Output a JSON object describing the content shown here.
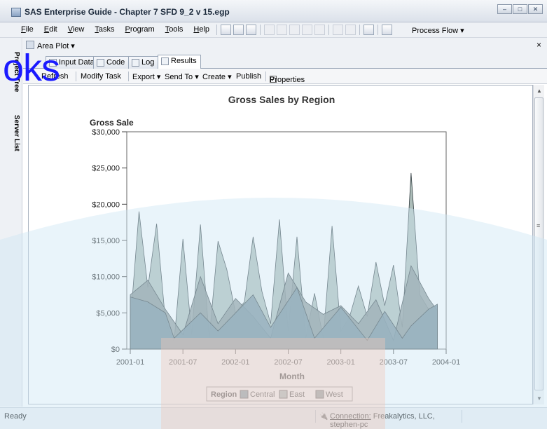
{
  "window": {
    "title": "SAS Enterprise Guide - Chapter 7 SFD 9_2 v 15.egp",
    "min_btn": "–",
    "max_btn": "□",
    "close_btn": "✕"
  },
  "menubar": {
    "items": [
      "File",
      "Edit",
      "View",
      "Tasks",
      "Program",
      "Tools",
      "Help"
    ],
    "process_flow": "Process Flow ▾"
  },
  "watermark_text": "oks",
  "sidebar": {
    "project_tree": "Project Tree",
    "server_list": "Server List"
  },
  "panel": {
    "name": "Area Plot ▾",
    "close": "×"
  },
  "tabs": [
    "Input Data",
    "Code",
    "Log",
    "Results"
  ],
  "active_tab": "Results",
  "actions": {
    "refresh": "Refresh",
    "modify": "Modify Task",
    "export": "Export ▾",
    "send_to": "Send To ▾",
    "create": "Create ▾",
    "publish": "Publish",
    "properties": "Properties"
  },
  "status": {
    "ready": "Ready",
    "connection_label": "Connection:",
    "connection_value": "Freakalytics, LLC, stephen-pc"
  },
  "colors": {
    "central": "#6f8a96",
    "east": "#9fb1ad",
    "west": "#7f8c8c",
    "plot_bg": "#ffffff",
    "watermark_blue": "#cfe7f3",
    "watermark_pink": "#efc8ba"
  },
  "chart_data": {
    "type": "area",
    "title": "Gross Sales by Region",
    "ylabel": "Gross Sale",
    "xlabel": "Month",
    "ylim": [
      0,
      30000
    ],
    "yticks": [
      0,
      5000,
      10000,
      15000,
      20000,
      25000,
      30000
    ],
    "ytick_labels": [
      "$0",
      "$5,000",
      "$10,000",
      "$15,000",
      "$20,000",
      "$25,000",
      "$30,000"
    ],
    "xlim": [
      "2001-01",
      "2004-01"
    ],
    "xtick_labels": [
      "2001-01",
      "2001-07",
      "2002-01",
      "2002-07",
      "2003-01",
      "2003-07",
      "2004-01"
    ],
    "legend_title": "Region",
    "legend_position": "bottom",
    "series": [
      {
        "name": "Central",
        "x": [
          "2001-01",
          "2001-03",
          "2001-05",
          "2001-06",
          "2001-09",
          "2001-11",
          "2002-03",
          "2002-05",
          "2002-08",
          "2002-10",
          "2003-01",
          "2003-04",
          "2003-06",
          "2003-08",
          "2003-09",
          "2003-11",
          "2003-12"
        ],
        "values": [
          7200,
          6500,
          5000,
          1500,
          5000,
          2500,
          7500,
          3000,
          8500,
          1500,
          5800,
          1200,
          5200,
          1500,
          3200,
          5500,
          6200
        ]
      },
      {
        "name": "East",
        "x": [
          "2001-01",
          "2001-02",
          "2001-03",
          "2001-04",
          "2001-05",
          "2001-06",
          "2001-07",
          "2001-08",
          "2001-09",
          "2001-10",
          "2001-11",
          "2001-12",
          "2002-01",
          "2002-02",
          "2002-03",
          "2002-04",
          "2002-05",
          "2002-06",
          "2002-07",
          "2002-08",
          "2002-09",
          "2002-10",
          "2002-11",
          "2002-12",
          "2003-01",
          "2003-02",
          "2003-03",
          "2003-04",
          "2003-05",
          "2003-06",
          "2003-07",
          "2003-08",
          "2003-09",
          "2003-10",
          "2003-11",
          "2003-12"
        ],
        "values": [
          3500,
          19000,
          8500,
          17300,
          4000,
          1000,
          15200,
          2000,
          17200,
          1500,
          14900,
          11000,
          5000,
          6500,
          15500,
          8000,
          3500,
          17900,
          2500,
          15500,
          1500,
          7700,
          1500,
          17000,
          2500,
          4500,
          8700,
          4500,
          12000,
          6000,
          11600,
          3000,
          24300,
          7500,
          5500,
          6000
        ]
      },
      {
        "name": "West",
        "x": [
          "2001-01",
          "2001-03",
          "2001-05",
          "2001-07",
          "2001-09",
          "2001-11",
          "2002-01",
          "2002-03",
          "2002-05",
          "2002-07",
          "2002-09",
          "2002-11",
          "2003-01",
          "2003-03",
          "2003-05",
          "2003-07",
          "2003-09",
          "2003-11",
          "2003-12"
        ],
        "values": [
          7500,
          9500,
          5500,
          2000,
          10000,
          3500,
          7000,
          4500,
          1500,
          10500,
          6500,
          4800,
          6000,
          3500,
          6800,
          1200,
          11500,
          7000,
          5300
        ]
      }
    ]
  }
}
